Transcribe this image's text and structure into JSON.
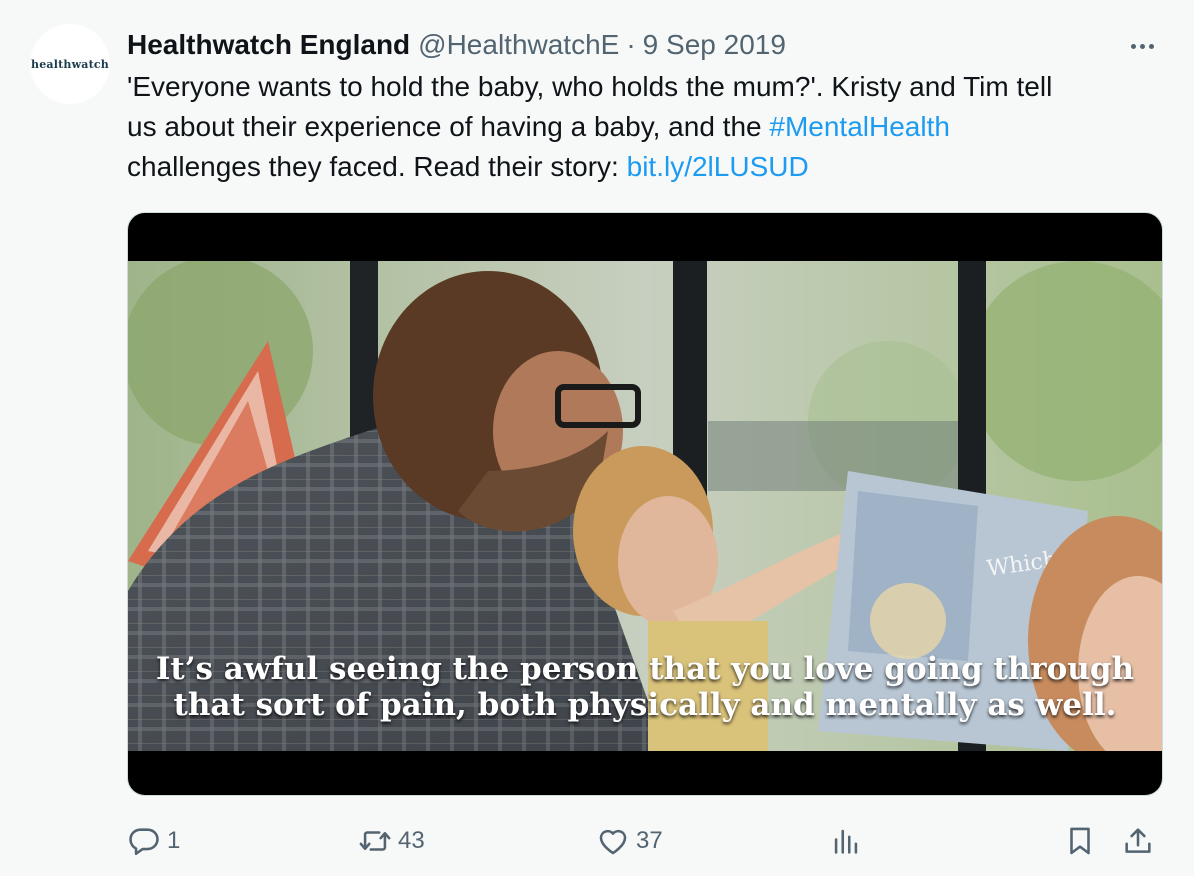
{
  "author": {
    "name": "Healthwatch England",
    "handle": "@HealthwatchE",
    "separator": "·",
    "date": "9 Sep 2019",
    "avatar_logo": "healthwatch"
  },
  "tweet": {
    "line1": "'Everyone wants to hold the baby, who holds the mum?'. Kristy and Tim tell",
    "line2_text": "us about their experience of having a baby, and the ",
    "hashtag": "#MentalHealth",
    "line3_text": "challenges they faced. Read their story: ",
    "link": "bit.ly/2lLUSUD"
  },
  "media": {
    "caption_line1": "It’s awful seeing the person that you love going through",
    "caption_line2": "that sort of pain, both physically and mentally as well.",
    "book_text": "Which"
  },
  "actions": {
    "replies": "1",
    "retweets": "43",
    "likes": "37"
  },
  "icons": [
    "more-icon",
    "reply-icon",
    "retweet-icon",
    "like-icon",
    "views-icon",
    "bookmark-icon",
    "share-icon"
  ],
  "colors": {
    "background": "#f7f9f9",
    "link": "#1d9bf0",
    "secondary_text": "#536471",
    "primary_text": "#0f1419"
  }
}
